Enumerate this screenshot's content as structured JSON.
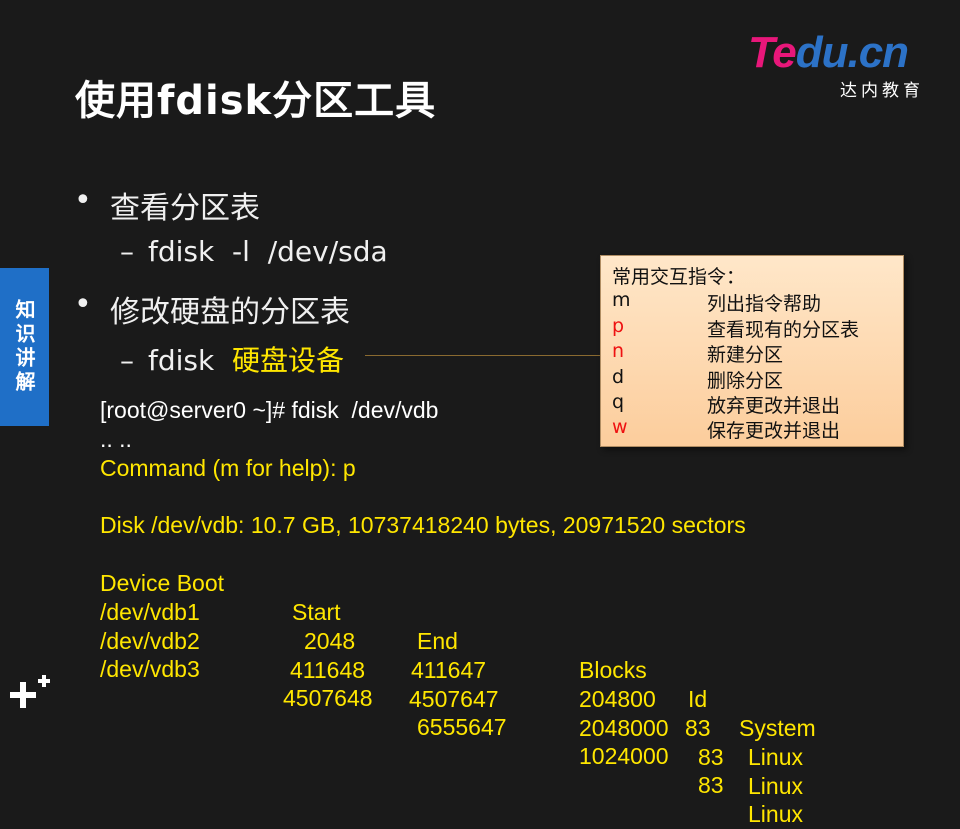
{
  "slide": {
    "title": "使用fdisk分区工具",
    "side_tab": "知识讲解",
    "bullets": [
      {
        "text": "查看分区表",
        "sub": {
          "command": "fdisk  -l  /dev/sda"
        }
      },
      {
        "text": "修改硬盘的分区表",
        "sub": {
          "command": "fdisk",
          "highlight": "硬盘设备"
        }
      }
    ]
  },
  "logo": {
    "part1": "Te",
    "part2": "du.cn",
    "sub": "达内教育",
    "colors": {
      "part1": "#e8177a",
      "part2": "#2c72c7"
    }
  },
  "popup": {
    "heading": "常用交互指令：",
    "commands": [
      {
        "key": "m",
        "desc": "列出指令帮助",
        "color": "#111111"
      },
      {
        "key": "p",
        "desc": "查看现有的分区表",
        "color": "#ee1111"
      },
      {
        "key": "n",
        "desc": "新建分区",
        "color": "#ee1111"
      },
      {
        "key": "d",
        "desc": "删除分区",
        "color": "#111111"
      },
      {
        "key": "q",
        "desc": "放弃更改并退出",
        "color": "#111111"
      },
      {
        "key": "w",
        "desc": "保存更改并退出",
        "color": "#ee1111"
      }
    ]
  },
  "terminal": {
    "prompt_line": "[root@server0 ~]# fdisk  /dev/vdb",
    "ellipsis": ".. ..",
    "command_line": "Command (m for help): p",
    "disk_info": "Disk /dev/vdb: 10.7 GB, 10737418240 bytes, 20971520 sectors",
    "headers": [
      "Device Boot",
      "Start",
      "End",
      "Blocks",
      "Id",
      "System"
    ],
    "rows": [
      [
        "/dev/vdb1",
        "2048",
        "411647",
        "204800",
        "83",
        "Linux"
      ],
      [
        "/dev/vdb2",
        "411648",
        "4507647",
        "2048000",
        "83",
        "Linux"
      ],
      [
        "/dev/vdb3",
        "4507648",
        "6555647",
        "1024000",
        "83",
        "Linux"
      ]
    ]
  },
  "colors": {
    "background": "#1a1a1a",
    "accent_yellow": "#ffe600",
    "tab_blue": "#1f6fc7"
  }
}
